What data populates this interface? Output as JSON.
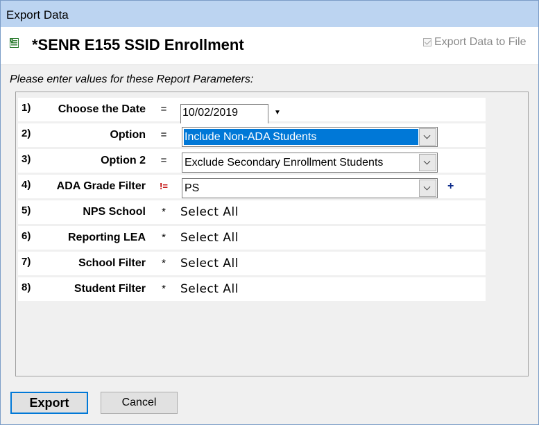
{
  "window": {
    "title": "Export Data"
  },
  "header": {
    "report_title": "*SENR E155 SSID Enrollment",
    "export_to_file_label": "Export Data to File",
    "export_to_file_checked": true
  },
  "prompt": "Please enter values for these Report Parameters:",
  "params": [
    {
      "num": "1)",
      "label": "Choose the Date",
      "op": "=",
      "value": "10/02/2019",
      "control": "date"
    },
    {
      "num": "2)",
      "label": "Option",
      "op": "=",
      "value": "Include Non-ADA Students",
      "control": "select",
      "selected": true
    },
    {
      "num": "3)",
      "label": "Option 2",
      "op": "=",
      "value": "Exclude Secondary Enrollment Students",
      "control": "select"
    },
    {
      "num": "4)",
      "label": "ADA Grade Filter",
      "op": "!=",
      "value": "PS",
      "control": "select",
      "extra": "+"
    },
    {
      "num": "5)",
      "label": "NPS School",
      "op": "*",
      "value": "Select All",
      "control": "text"
    },
    {
      "num": "6)",
      "label": "Reporting LEA",
      "op": "*",
      "value": "Select All",
      "control": "text"
    },
    {
      "num": "7)",
      "label": "School Filter",
      "op": "*",
      "value": "Select All",
      "control": "text"
    },
    {
      "num": "8)",
      "label": "Student Filter",
      "op": "*",
      "value": "Select All",
      "control": "text"
    }
  ],
  "buttons": {
    "export": "Export",
    "cancel": "Cancel"
  },
  "colors": {
    "titlebar": "#bcd4f1",
    "selection": "#0078d7",
    "default_button_border": "#0078d7"
  }
}
